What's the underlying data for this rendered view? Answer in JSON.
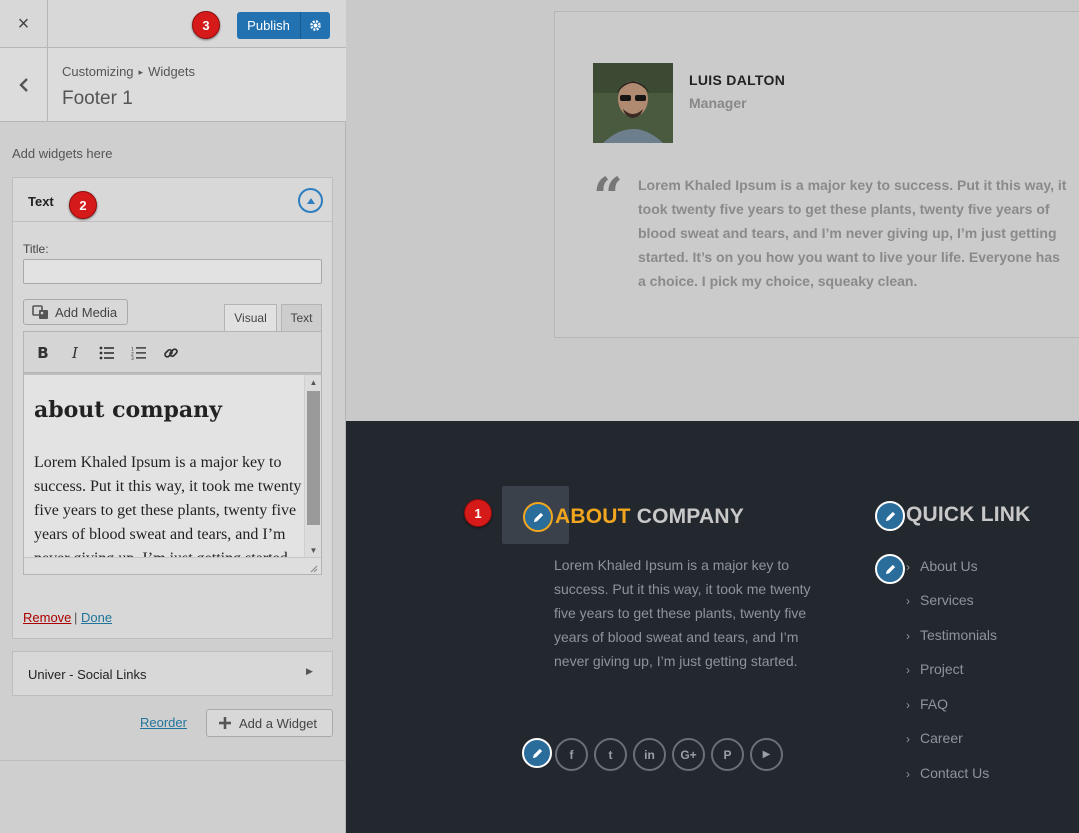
{
  "sidebar": {
    "close_label": "×",
    "publish_label": "Publish",
    "badges": [
      "1",
      "2",
      "3"
    ],
    "breadcrumb": {
      "root": "Customizing",
      "separator": "▸",
      "current": "Widgets"
    },
    "panel_title": "Footer 1",
    "add_widgets_note": "Add widgets here",
    "text_widget": {
      "header": "Text",
      "title_label": "Title:",
      "title_value": "",
      "add_media_label": "Add Media",
      "tab_visual": "Visual",
      "tab_text": "Text",
      "toolbar": [
        "bold",
        "italic",
        "bullet-list",
        "numbered-list",
        "link"
      ],
      "editor_heading": "about company",
      "editor_paragraph": "Lorem Khaled Ipsum is a major key to success. Put it this way, it took me twenty five years to get these plants, twenty five years of blood sweat and tears, and I’m never giving up, I’m just getting started.",
      "remove_label": "Remove",
      "separator": "|",
      "done_label": "Done"
    },
    "social_widget_label": "Univer - Social Links",
    "reorder_label": "Reorder",
    "add_widget_label": "Add a Widget"
  },
  "preview": {
    "testimonial": {
      "name": "LUIS DALTON",
      "role": "Manager",
      "quote": "Lorem Khaled Ipsum is a major key to success. Put it this way, it took twenty five years to get these plants, twenty five years of blood sweat and tears, and I’m never giving up, I’m just getting started. It’s on you how you want to live your life. Everyone has a choice. I pick my choice, squeaky clean."
    },
    "footer": {
      "about_title_accent": "ABOUT",
      "about_title_rest": "COMPANY",
      "about_text": "Lorem Khaled Ipsum is a major key to success. Put it this way, it took me twenty five years to get these plants, twenty five years of blood sweat and tears, and I’m never giving up, I’m just getting started.",
      "social_icons": [
        "facebook-icon",
        "twitter-icon",
        "linkedin-icon",
        "google-plus-icon",
        "pinterest-icon",
        "youtube-icon"
      ],
      "social_glyphs": [
        "f",
        "t",
        "in",
        "G+",
        "P",
        "▶"
      ],
      "quick_link_title": "QUICK LINK",
      "quick_links": [
        "About Us",
        "Services",
        "Testimonials",
        "Project",
        "FAQ",
        "Career",
        "Contact Us"
      ]
    }
  },
  "colors": {
    "publish_blue": "#2272b1",
    "footer_bg": "#23272e",
    "accent_orange": "#f2a61e",
    "badge_red": "#d61a1a",
    "edit_pencil": "#2a6c9a"
  }
}
